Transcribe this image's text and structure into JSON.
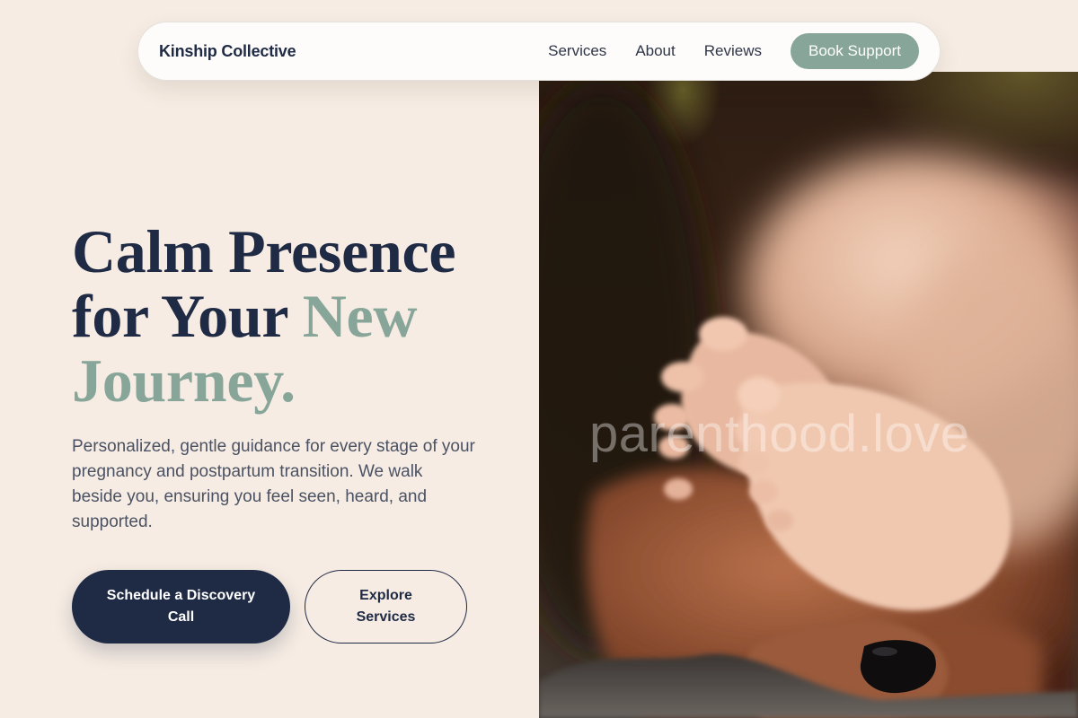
{
  "nav": {
    "brand": "Kinship Collective",
    "links": [
      "Services",
      "About",
      "Reviews"
    ],
    "cta": "Book Support"
  },
  "hero": {
    "title_line1": "Calm Presence",
    "title_line2_prefix": "for Your ",
    "title_accent_1": "New",
    "title_accent_2": "Journey.",
    "subtitle": "Personalized, gentle guidance for every stage of your pregnancy and postpartum transition. We walk beside you, ensuring you feel seen, heard, and supported.",
    "primary_button": "Schedule a Discovery Call",
    "secondary_button": "Explore Services"
  },
  "photo": {
    "watermark": "parenthood.love",
    "subject": "baby-feet-in-hands"
  },
  "colors": {
    "background": "#f6ece3",
    "navy": "#1f2a44",
    "sage": "#87a699",
    "body_text": "#4a5263"
  }
}
